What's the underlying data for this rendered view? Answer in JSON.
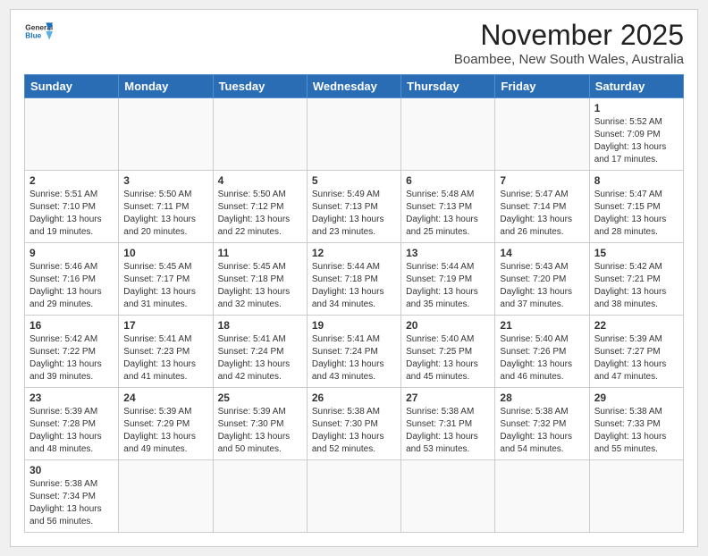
{
  "header": {
    "logo_general": "General",
    "logo_blue": "Blue",
    "month": "November 2025",
    "location": "Boambee, New South Wales, Australia"
  },
  "weekdays": [
    "Sunday",
    "Monday",
    "Tuesday",
    "Wednesday",
    "Thursday",
    "Friday",
    "Saturday"
  ],
  "weeks": [
    [
      {
        "day": "",
        "info": ""
      },
      {
        "day": "",
        "info": ""
      },
      {
        "day": "",
        "info": ""
      },
      {
        "day": "",
        "info": ""
      },
      {
        "day": "",
        "info": ""
      },
      {
        "day": "",
        "info": ""
      },
      {
        "day": "1",
        "info": "Sunrise: 5:52 AM\nSunset: 7:09 PM\nDaylight: 13 hours\nand 17 minutes."
      }
    ],
    [
      {
        "day": "2",
        "info": "Sunrise: 5:51 AM\nSunset: 7:10 PM\nDaylight: 13 hours\nand 19 minutes."
      },
      {
        "day": "3",
        "info": "Sunrise: 5:50 AM\nSunset: 7:11 PM\nDaylight: 13 hours\nand 20 minutes."
      },
      {
        "day": "4",
        "info": "Sunrise: 5:50 AM\nSunset: 7:12 PM\nDaylight: 13 hours\nand 22 minutes."
      },
      {
        "day": "5",
        "info": "Sunrise: 5:49 AM\nSunset: 7:13 PM\nDaylight: 13 hours\nand 23 minutes."
      },
      {
        "day": "6",
        "info": "Sunrise: 5:48 AM\nSunset: 7:13 PM\nDaylight: 13 hours\nand 25 minutes."
      },
      {
        "day": "7",
        "info": "Sunrise: 5:47 AM\nSunset: 7:14 PM\nDaylight: 13 hours\nand 26 minutes."
      },
      {
        "day": "8",
        "info": "Sunrise: 5:47 AM\nSunset: 7:15 PM\nDaylight: 13 hours\nand 28 minutes."
      }
    ],
    [
      {
        "day": "9",
        "info": "Sunrise: 5:46 AM\nSunset: 7:16 PM\nDaylight: 13 hours\nand 29 minutes."
      },
      {
        "day": "10",
        "info": "Sunrise: 5:45 AM\nSunset: 7:17 PM\nDaylight: 13 hours\nand 31 minutes."
      },
      {
        "day": "11",
        "info": "Sunrise: 5:45 AM\nSunset: 7:18 PM\nDaylight: 13 hours\nand 32 minutes."
      },
      {
        "day": "12",
        "info": "Sunrise: 5:44 AM\nSunset: 7:18 PM\nDaylight: 13 hours\nand 34 minutes."
      },
      {
        "day": "13",
        "info": "Sunrise: 5:44 AM\nSunset: 7:19 PM\nDaylight: 13 hours\nand 35 minutes."
      },
      {
        "day": "14",
        "info": "Sunrise: 5:43 AM\nSunset: 7:20 PM\nDaylight: 13 hours\nand 37 minutes."
      },
      {
        "day": "15",
        "info": "Sunrise: 5:42 AM\nSunset: 7:21 PM\nDaylight: 13 hours\nand 38 minutes."
      }
    ],
    [
      {
        "day": "16",
        "info": "Sunrise: 5:42 AM\nSunset: 7:22 PM\nDaylight: 13 hours\nand 39 minutes."
      },
      {
        "day": "17",
        "info": "Sunrise: 5:41 AM\nSunset: 7:23 PM\nDaylight: 13 hours\nand 41 minutes."
      },
      {
        "day": "18",
        "info": "Sunrise: 5:41 AM\nSunset: 7:24 PM\nDaylight: 13 hours\nand 42 minutes."
      },
      {
        "day": "19",
        "info": "Sunrise: 5:41 AM\nSunset: 7:24 PM\nDaylight: 13 hours\nand 43 minutes."
      },
      {
        "day": "20",
        "info": "Sunrise: 5:40 AM\nSunset: 7:25 PM\nDaylight: 13 hours\nand 45 minutes."
      },
      {
        "day": "21",
        "info": "Sunrise: 5:40 AM\nSunset: 7:26 PM\nDaylight: 13 hours\nand 46 minutes."
      },
      {
        "day": "22",
        "info": "Sunrise: 5:39 AM\nSunset: 7:27 PM\nDaylight: 13 hours\nand 47 minutes."
      }
    ],
    [
      {
        "day": "23",
        "info": "Sunrise: 5:39 AM\nSunset: 7:28 PM\nDaylight: 13 hours\nand 48 minutes."
      },
      {
        "day": "24",
        "info": "Sunrise: 5:39 AM\nSunset: 7:29 PM\nDaylight: 13 hours\nand 49 minutes."
      },
      {
        "day": "25",
        "info": "Sunrise: 5:39 AM\nSunset: 7:30 PM\nDaylight: 13 hours\nand 50 minutes."
      },
      {
        "day": "26",
        "info": "Sunrise: 5:38 AM\nSunset: 7:30 PM\nDaylight: 13 hours\nand 52 minutes."
      },
      {
        "day": "27",
        "info": "Sunrise: 5:38 AM\nSunset: 7:31 PM\nDaylight: 13 hours\nand 53 minutes."
      },
      {
        "day": "28",
        "info": "Sunrise: 5:38 AM\nSunset: 7:32 PM\nDaylight: 13 hours\nand 54 minutes."
      },
      {
        "day": "29",
        "info": "Sunrise: 5:38 AM\nSunset: 7:33 PM\nDaylight: 13 hours\nand 55 minutes."
      }
    ],
    [
      {
        "day": "30",
        "info": "Sunrise: 5:38 AM\nSunset: 7:34 PM\nDaylight: 13 hours\nand 56 minutes."
      },
      {
        "day": "",
        "info": ""
      },
      {
        "day": "",
        "info": ""
      },
      {
        "day": "",
        "info": ""
      },
      {
        "day": "",
        "info": ""
      },
      {
        "day": "",
        "info": ""
      },
      {
        "day": "",
        "info": ""
      }
    ]
  ]
}
